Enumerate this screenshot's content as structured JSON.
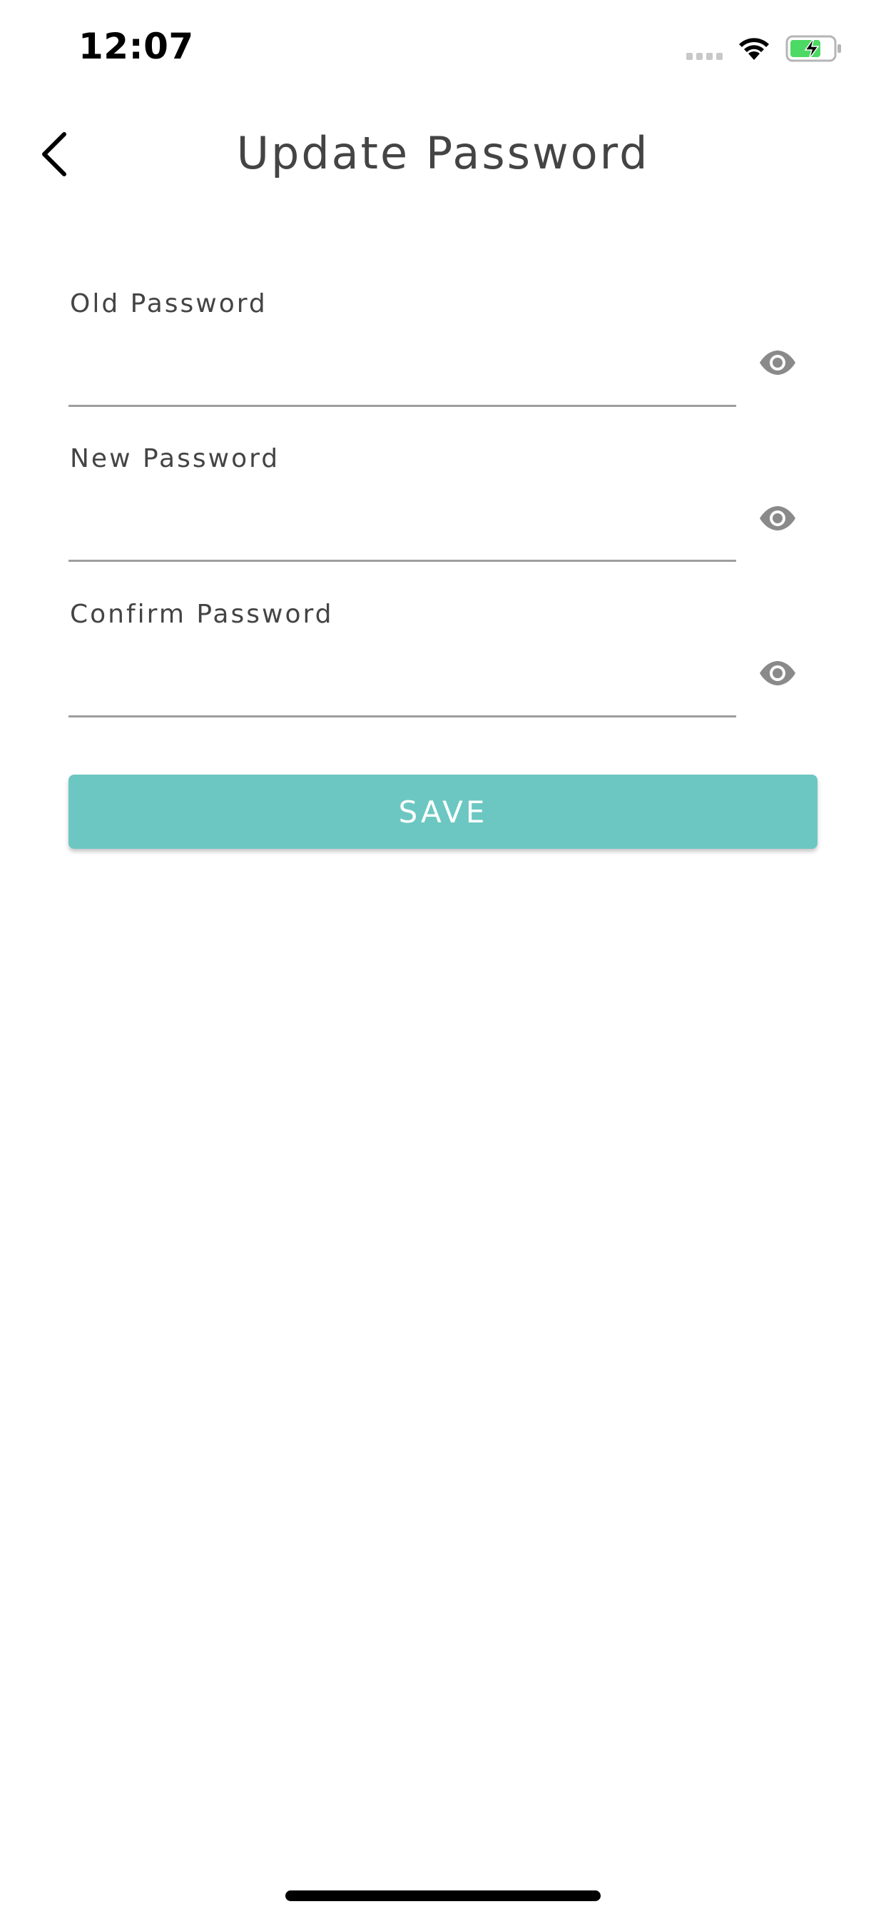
{
  "status_bar": {
    "time": "12:07",
    "icons": [
      "signal-icon",
      "wifi-icon",
      "battery-charging-icon"
    ],
    "battery_color": "#4cd964"
  },
  "header": {
    "title": "Update Password",
    "back_icon": "chevron-left-icon"
  },
  "form": {
    "fields": [
      {
        "label": "Old Password",
        "value": "",
        "toggle_icon": "eye-icon"
      },
      {
        "label": "New Password",
        "value": "",
        "toggle_icon": "eye-icon"
      },
      {
        "label": "Confirm Password",
        "value": "",
        "toggle_icon": "eye-icon"
      }
    ],
    "save_label": "SAVE"
  },
  "colors": {
    "accent": "#6cc7c2",
    "text": "#444444",
    "underline": "#9e9e9e",
    "icon": "#8a8a8a"
  }
}
